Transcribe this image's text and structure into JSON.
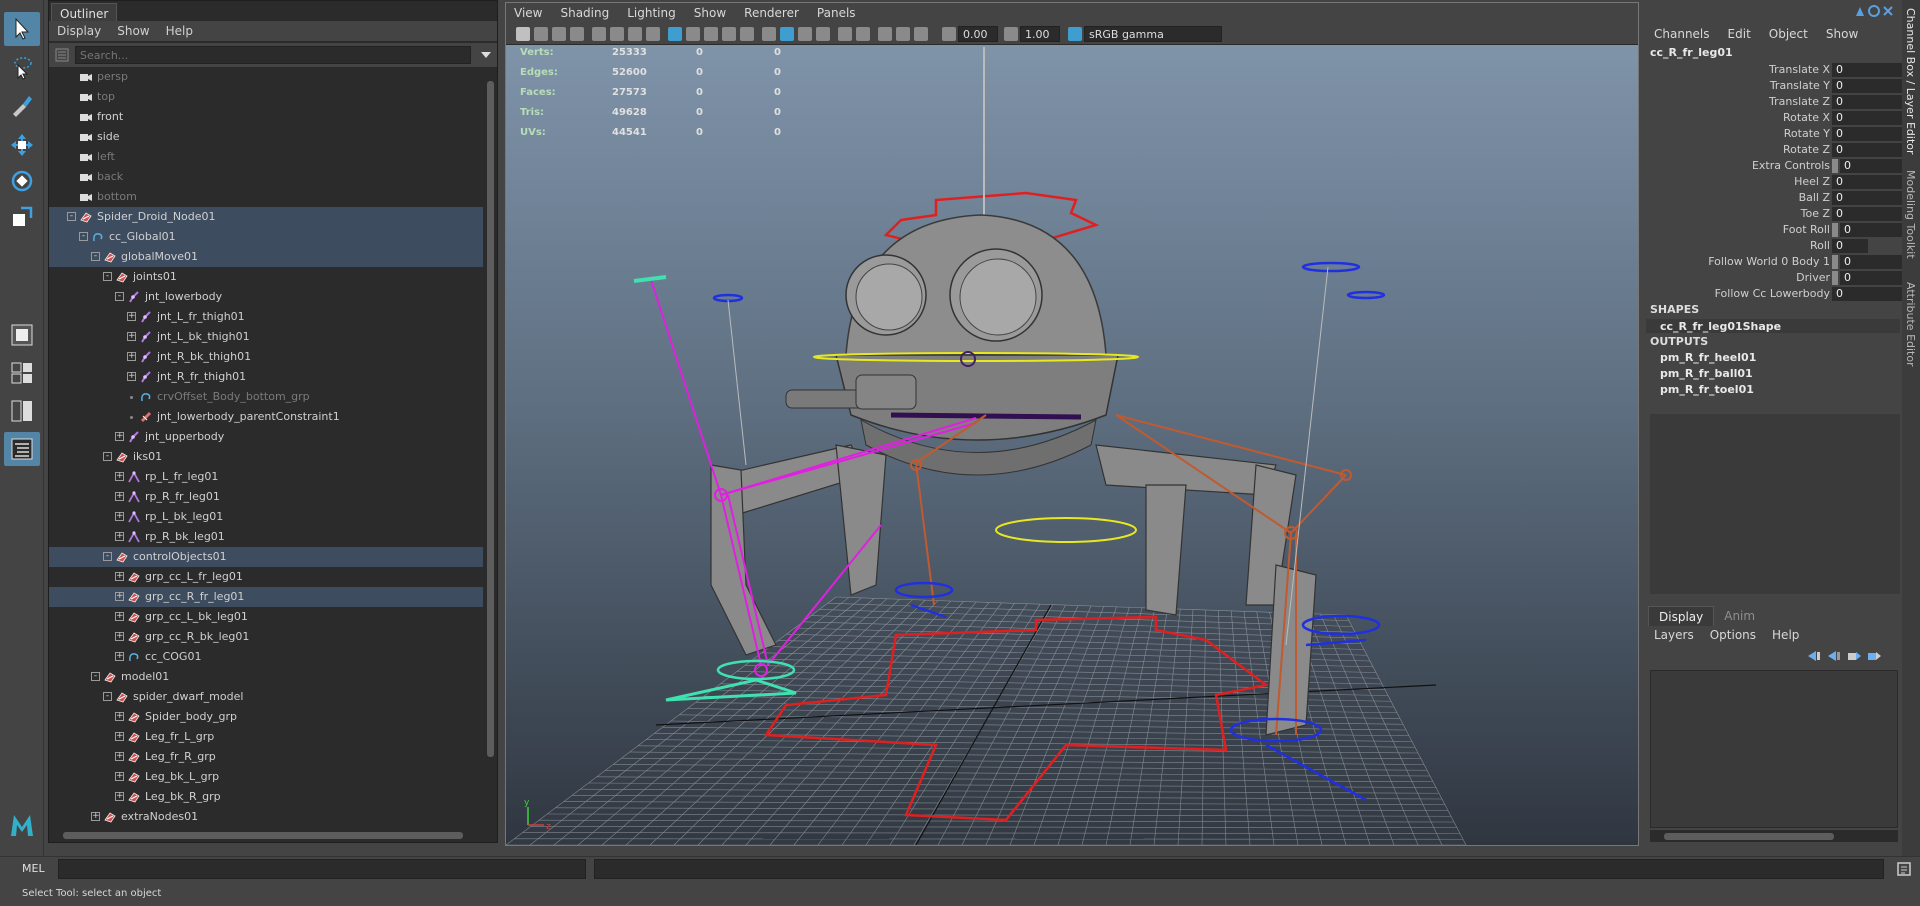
{
  "outliner": {
    "tab_label": "Outliner",
    "menu": [
      "Display",
      "Show",
      "Help"
    ],
    "search_placeholder": "Search...",
    "rows": [
      {
        "label": "persp",
        "depth": 1,
        "icon": "camera",
        "dim": true
      },
      {
        "label": "top",
        "depth": 1,
        "icon": "camera",
        "dim": true
      },
      {
        "label": "front",
        "depth": 1,
        "icon": "camera"
      },
      {
        "label": "side",
        "depth": 1,
        "icon": "camera"
      },
      {
        "label": "left",
        "depth": 1,
        "icon": "camera",
        "dim": true
      },
      {
        "label": "back",
        "depth": 1,
        "icon": "camera",
        "dim": true
      },
      {
        "label": "bottom",
        "depth": 1,
        "icon": "camera",
        "dim": true
      },
      {
        "label": "Spider_Droid_Node01",
        "depth": 1,
        "icon": "transform",
        "exp": "-",
        "sel": true
      },
      {
        "label": "cc_Global01",
        "depth": 2,
        "icon": "curve",
        "exp": "-",
        "sel": true
      },
      {
        "label": "globalMove01",
        "depth": 3,
        "icon": "transform",
        "exp": "-",
        "sel": true
      },
      {
        "label": "joints01",
        "depth": 4,
        "icon": "transform",
        "exp": "-"
      },
      {
        "label": "jnt_lowerbody",
        "depth": 5,
        "icon": "joint",
        "exp": "-"
      },
      {
        "label": "jnt_L_fr_thigh01",
        "depth": 6,
        "icon": "joint",
        "exp": "+"
      },
      {
        "label": "jnt_L_bk_thigh01",
        "depth": 6,
        "icon": "joint",
        "exp": "+"
      },
      {
        "label": "jnt_R_bk_thigh01",
        "depth": 6,
        "icon": "joint",
        "exp": "+"
      },
      {
        "label": "jnt_R_fr_thigh01",
        "depth": 6,
        "icon": "joint",
        "exp": "+"
      },
      {
        "label": "crvOffset_Body_bottom_grp",
        "depth": 6,
        "icon": "curve",
        "exp": "dot",
        "dim": true
      },
      {
        "label": "jnt_lowerbody_parentConstraint1",
        "depth": 6,
        "icon": "constraint",
        "exp": "dot"
      },
      {
        "label": "jnt_upperbody",
        "depth": 5,
        "icon": "joint",
        "exp": "+"
      },
      {
        "label": "iks01",
        "depth": 4,
        "icon": "transform",
        "exp": "-"
      },
      {
        "label": "rp_L_fr_leg01",
        "depth": 5,
        "icon": "ik",
        "exp": "+"
      },
      {
        "label": "rp_R_fr_leg01",
        "depth": 5,
        "icon": "ik",
        "exp": "+"
      },
      {
        "label": "rp_L_bk_leg01",
        "depth": 5,
        "icon": "ik",
        "exp": "+"
      },
      {
        "label": "rp_R_bk_leg01",
        "depth": 5,
        "icon": "ik",
        "exp": "+"
      },
      {
        "label": "controlObjects01",
        "depth": 4,
        "icon": "transform",
        "exp": "-",
        "sel": true
      },
      {
        "label": "grp_cc_L_fr_leg01",
        "depth": 5,
        "icon": "transform",
        "exp": "+"
      },
      {
        "label": "grp_cc_R_fr_leg01",
        "depth": 5,
        "icon": "transform",
        "exp": "+",
        "sel": true
      },
      {
        "label": "grp_cc_L_bk_leg01",
        "depth": 5,
        "icon": "transform",
        "exp": "+"
      },
      {
        "label": "grp_cc_R_bk_leg01",
        "depth": 5,
        "icon": "transform",
        "exp": "+"
      },
      {
        "label": "cc_COG01",
        "depth": 5,
        "icon": "curve",
        "exp": "+"
      },
      {
        "label": "model01",
        "depth": 3,
        "icon": "transform",
        "exp": "-"
      },
      {
        "label": "spider_dwarf_model",
        "depth": 4,
        "icon": "transform",
        "exp": "-"
      },
      {
        "label": "Spider_body_grp",
        "depth": 5,
        "icon": "transform",
        "exp": "+"
      },
      {
        "label": "Leg_fr_L_grp",
        "depth": 5,
        "icon": "transform",
        "exp": "+"
      },
      {
        "label": "Leg_fr_R_grp",
        "depth": 5,
        "icon": "transform",
        "exp": "+"
      },
      {
        "label": "Leg_bk_L_grp",
        "depth": 5,
        "icon": "transform",
        "exp": "+"
      },
      {
        "label": "Leg_bk_R_grp",
        "depth": 5,
        "icon": "transform",
        "exp": "+"
      },
      {
        "label": "extraNodes01",
        "depth": 3,
        "icon": "transform",
        "exp": "+"
      }
    ]
  },
  "viewport": {
    "menu": [
      "View",
      "Shading",
      "Lighting",
      "Show",
      "Renderer",
      "Panels"
    ],
    "exposure": "0.00",
    "gamma": "1.00",
    "color_space": "sRGB gamma",
    "hud": [
      {
        "label": "Verts:",
        "v1": "25333",
        "v2": "0",
        "v3": "0"
      },
      {
        "label": "Edges:",
        "v1": "52600",
        "v2": "0",
        "v3": "0"
      },
      {
        "label": "Faces:",
        "v1": "27573",
        "v2": "0",
        "v3": "0"
      },
      {
        "label": "Tris:",
        "v1": "49628",
        "v2": "0",
        "v3": "0"
      },
      {
        "label": "UVs:",
        "v1": "44541",
        "v2": "0",
        "v3": "0"
      }
    ],
    "axis_y": "y",
    "axis_z": "z"
  },
  "channelbox": {
    "menu": [
      "Channels",
      "Edit",
      "Object",
      "Show"
    ],
    "node_name": "cc_R_fr_leg01",
    "attributes": [
      {
        "name": "Translate X",
        "value": "0"
      },
      {
        "name": "Translate Y",
        "value": "0"
      },
      {
        "name": "Translate Z",
        "value": "0"
      },
      {
        "name": "Rotate X",
        "value": "0"
      },
      {
        "name": "Rotate Y",
        "value": "0"
      },
      {
        "name": "Rotate Z",
        "value": "0"
      },
      {
        "name": "Extra Controls",
        "value": "0",
        "grey": true
      },
      {
        "name": "Heel Z",
        "value": "0"
      },
      {
        "name": "Ball Z",
        "value": "0"
      },
      {
        "name": "Toe Z",
        "value": "0"
      },
      {
        "name": "Foot Roll",
        "value": "0",
        "grey": true
      },
      {
        "name": "Roll",
        "value": "0",
        "short": true
      },
      {
        "name": "Follow World 0 Body 1",
        "value": "0",
        "grey": true
      },
      {
        "name": "Driver",
        "value": "0",
        "grey": true
      },
      {
        "name": "Follow Cc Lowerbody",
        "value": "0"
      }
    ],
    "shapes_header": "SHAPES",
    "shape": "cc_R_fr_leg01Shape",
    "outputs_header": "OUTPUTS",
    "outputs": [
      "pm_R_fr_heel01",
      "pm_R_fr_ball01",
      "pm_R_fr_toel01"
    ]
  },
  "layer_editor": {
    "tabs": [
      "Display",
      "Anim"
    ],
    "menu": [
      "Layers",
      "Options",
      "Help"
    ]
  },
  "side_tabs": [
    "Channel Box / Layer Editor",
    "Modeling Toolkit",
    "Attribute Editor"
  ],
  "cmdline": {
    "label": "MEL",
    "value": ""
  },
  "helpline": {
    "text": "Select Tool: select an object"
  },
  "colors": {
    "selection": "#3d4d5f",
    "accent": "#5285a6",
    "joint": "#b07ae0",
    "constraint": "#e07070"
  }
}
